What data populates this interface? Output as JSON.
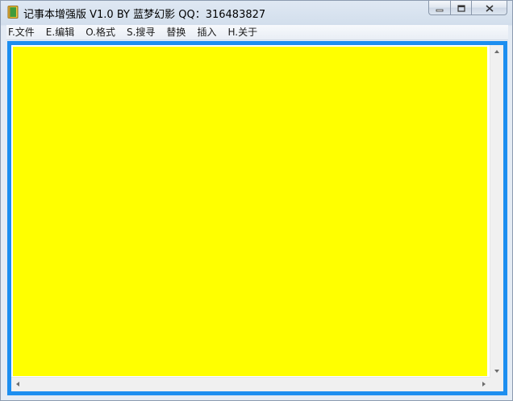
{
  "window": {
    "title": "记事本增强版 V1.0 BY 蓝梦幻影 QQ：316483827",
    "icon": "notebook-icon",
    "controls": {
      "minimize": "minimize-icon",
      "maximize": "maximize-icon",
      "close": "close-icon"
    }
  },
  "menu": {
    "items": [
      {
        "label": "F.文件"
      },
      {
        "label": "E.编辑"
      },
      {
        "label": "O.格式"
      },
      {
        "label": "S.搜寻"
      },
      {
        "label": "替换"
      },
      {
        "label": "插入"
      },
      {
        "label": "H.关于"
      }
    ]
  },
  "editor": {
    "content": "",
    "background_color": "#ffff00",
    "frame_color": "#1c8ef0"
  }
}
